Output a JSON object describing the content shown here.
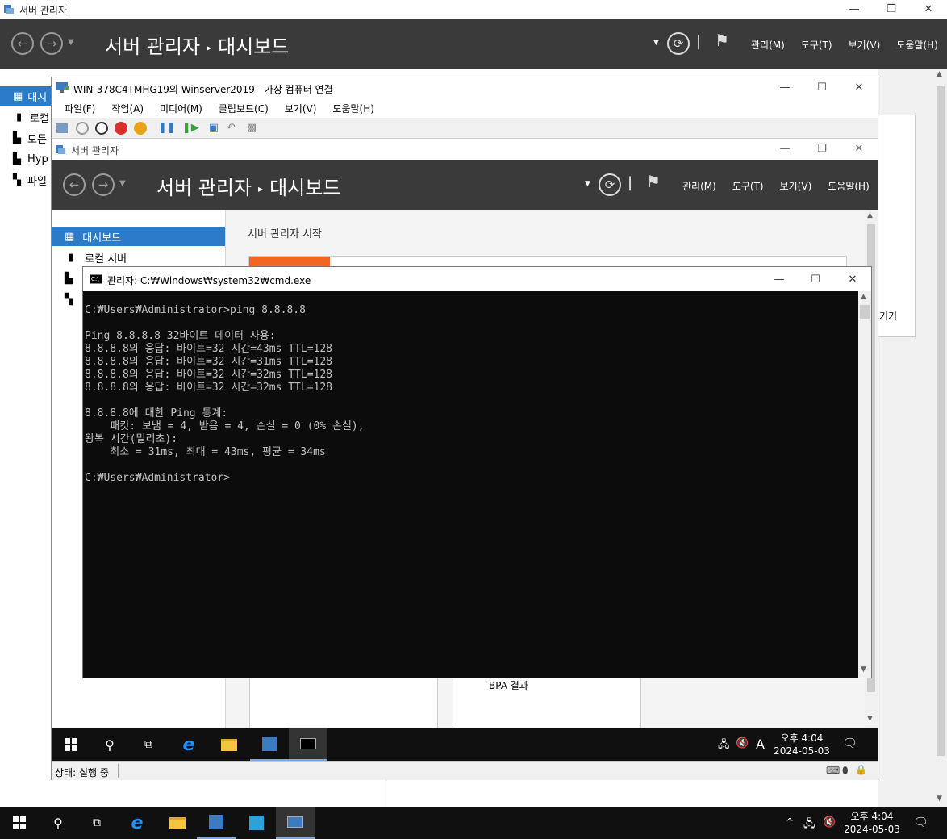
{
  "outer": {
    "window_title": "서버 관리자",
    "breadcrumb_app": "서버 관리자",
    "breadcrumb_page": "대시보드",
    "menu": [
      "관리(M)",
      "도구(T)",
      "보기(V)",
      "도움말(H)"
    ],
    "sidebar": [
      "대시",
      "로컬",
      "모든",
      "Hyp",
      "파일"
    ],
    "right_text": "기기"
  },
  "vm": {
    "title": "WIN-378C4TMHG19의 Winserver2019 - 가상 컴퓨터 연결",
    "menu": [
      "파일(F)",
      "작업(A)",
      "미디어(M)",
      "클립보드(C)",
      "보기(V)",
      "도움말(H)"
    ],
    "status": "상태: 실행 중"
  },
  "inner": {
    "window_title": "서버 관리자",
    "breadcrumb_app": "서버 관리자",
    "breadcrumb_page": "대시보드",
    "menu": [
      "관리(M)",
      "도구(T)",
      "보기(V)",
      "도움말(H)"
    ],
    "sidebar": [
      "대시보드",
      "로컬 서버"
    ],
    "main_heading": "서버 관리자 시작",
    "bpa": "BPA 결과",
    "clock_time": "오후 4:04",
    "clock_date": "2024-05-03",
    "ime": "A"
  },
  "cmd": {
    "title": "관리자: C:₩Windows₩system32₩cmd.exe",
    "lines": [
      "C:₩Users₩Administrator>ping 8.8.8.8",
      "",
      "Ping 8.8.8.8 32바이트 데이터 사용:",
      "8.8.8.8의 응답: 바이트=32 시간=43ms TTL=128",
      "8.8.8.8의 응답: 바이트=32 시간=31ms TTL=128",
      "8.8.8.8의 응답: 바이트=32 시간=32ms TTL=128",
      "8.8.8.8의 응답: 바이트=32 시간=32ms TTL=128",
      "",
      "8.8.8.8에 대한 Ping 통계:",
      "    패킷: 보냄 = 4, 받음 = 4, 손실 = 0 (0% 손실),",
      "왕복 시간(밀리초):",
      "    최소 = 31ms, 최대 = 43ms, 평균 = 34ms",
      "",
      "C:₩Users₩Administrator>"
    ]
  },
  "taskbar": {
    "clock_time": "오후 4:04",
    "clock_date": "2024-05-03"
  },
  "colors": {
    "header_bg": "#3a3a3a",
    "selected_blue": "#2b7bc8",
    "orange": "#f26522",
    "cmd_bg": "#0c0c0c"
  }
}
